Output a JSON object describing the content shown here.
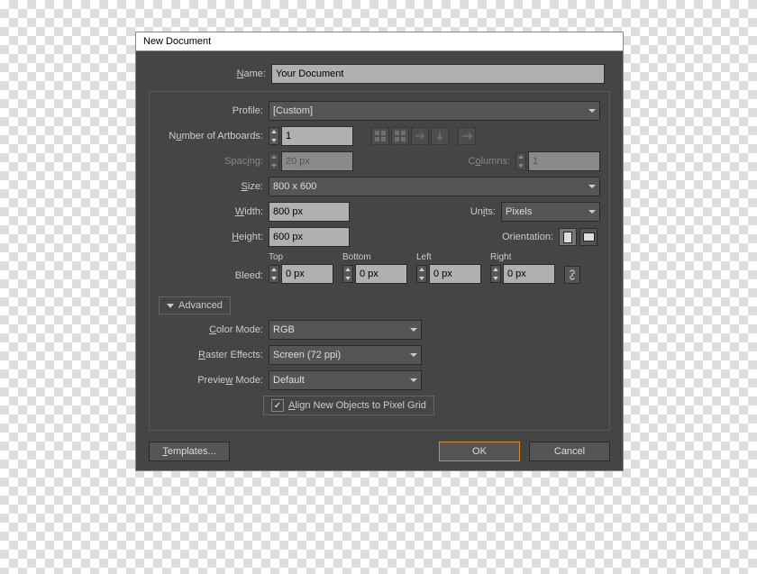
{
  "window": {
    "title": "New Document"
  },
  "fields": {
    "name_label": "Name:",
    "name_value": "Your Document",
    "profile_label": "Profile:",
    "profile_value": "[Custom]",
    "artboards_label": "Number of Artboards:",
    "artboards_value": "1",
    "spacing_label": "Spacing:",
    "spacing_value": "20 px",
    "columns_label": "Columns:",
    "columns_value": "1",
    "size_label": "Size:",
    "size_value": "800 x 600",
    "width_label": "Width:",
    "width_value": "800 px",
    "units_label": "Units:",
    "units_value": "Pixels",
    "height_label": "Height:",
    "height_value": "600 px",
    "orientation_label": "Orientation:",
    "bleed_label": "Bleed:",
    "bleed_top_label": "Top",
    "bleed_bottom_label": "Bottom",
    "bleed_left_label": "Left",
    "bleed_right_label": "Right",
    "bleed_top": "0 px",
    "bleed_bottom": "0 px",
    "bleed_left": "0 px",
    "bleed_right": "0 px",
    "advanced_label": "Advanced",
    "colormode_label": "Color Mode:",
    "colormode_value": "RGB",
    "raster_label": "Raster Effects:",
    "raster_value": "Screen (72 ppi)",
    "preview_label": "Preview Mode:",
    "preview_value": "Default",
    "align_label": "Align New Objects to Pixel Grid"
  },
  "buttons": {
    "templates": "Templates...",
    "ok": "OK",
    "cancel": "Cancel"
  }
}
